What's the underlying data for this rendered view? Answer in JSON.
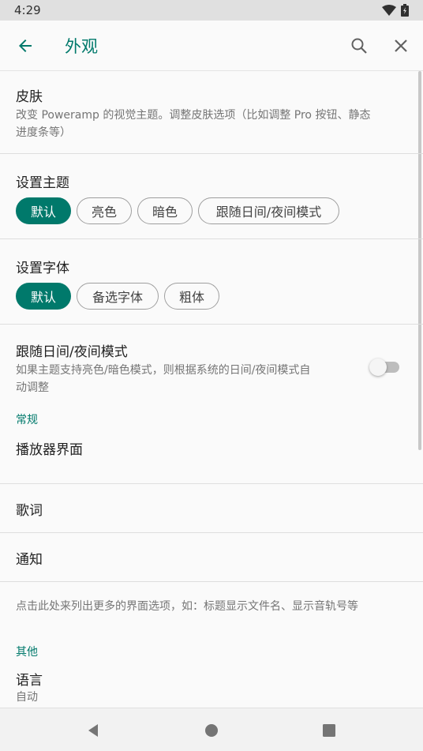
{
  "status_bar": {
    "time": "4:29",
    "icons": [
      "wifi-icon",
      "battery-icon"
    ]
  },
  "app_bar": {
    "title": "外观",
    "back_icon": "arrow-left-icon",
    "search_icon": "search-icon",
    "close_icon": "close-icon",
    "accent_color": "#00796b"
  },
  "skin": {
    "title": "皮肤",
    "subtitle_line1": "改变 Poweramp 的视觉主题。调整皮肤选项（比如调整 Pro 按钮、静态",
    "subtitle_line2": "进度条等）"
  },
  "theme": {
    "title": "设置主题",
    "options": [
      "默认",
      "亮色",
      "暗色",
      "跟随日间/夜间模式"
    ],
    "selected": "默认"
  },
  "font": {
    "title": "设置字体",
    "options": [
      "默认",
      "备选字体",
      "粗体"
    ],
    "selected": "默认"
  },
  "day_night": {
    "title": "跟随日间/夜间模式",
    "subtitle_line1": "如果主题支持亮色/暗色模式，则根据系统的日间/夜间模式自",
    "subtitle_line2": "动调整",
    "enabled": false
  },
  "general": {
    "header": "常规",
    "items": [
      "播放器界面",
      "歌词",
      "通知"
    ],
    "hint": "点击此处来列出更多的界面选项，如：标题显示文件名、显示音轨号等"
  },
  "other": {
    "header": "其他",
    "language_title": "语言",
    "language_value": "自动"
  },
  "nav_bar": {
    "icons": [
      "back-triangle-icon",
      "home-circle-icon",
      "recents-square-icon"
    ]
  }
}
